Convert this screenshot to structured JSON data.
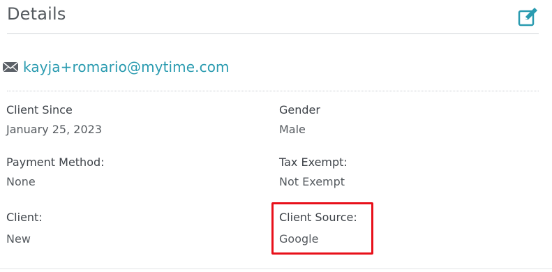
{
  "panel": {
    "title": "Details",
    "edit_icon": "edit-pencil-icon"
  },
  "contact": {
    "email_icon": "envelope-icon",
    "email": "kayja+romario@mytime.com"
  },
  "fields": {
    "client_since_label": "Client Since",
    "client_since_value": "January 25, 2023",
    "gender_label": "Gender",
    "gender_value": "Male",
    "payment_method_label": "Payment Method:",
    "payment_method_value": "None",
    "tax_exempt_label": "Tax Exempt:",
    "tax_exempt_value": "Not Exempt",
    "client_label": "Client:",
    "client_value": "New",
    "client_source_label": "Client Source:",
    "client_source_value": "Google"
  },
  "colors": {
    "accent": "#2a9bb0",
    "highlight_border": "#e8101a",
    "text": "#555a5f"
  }
}
